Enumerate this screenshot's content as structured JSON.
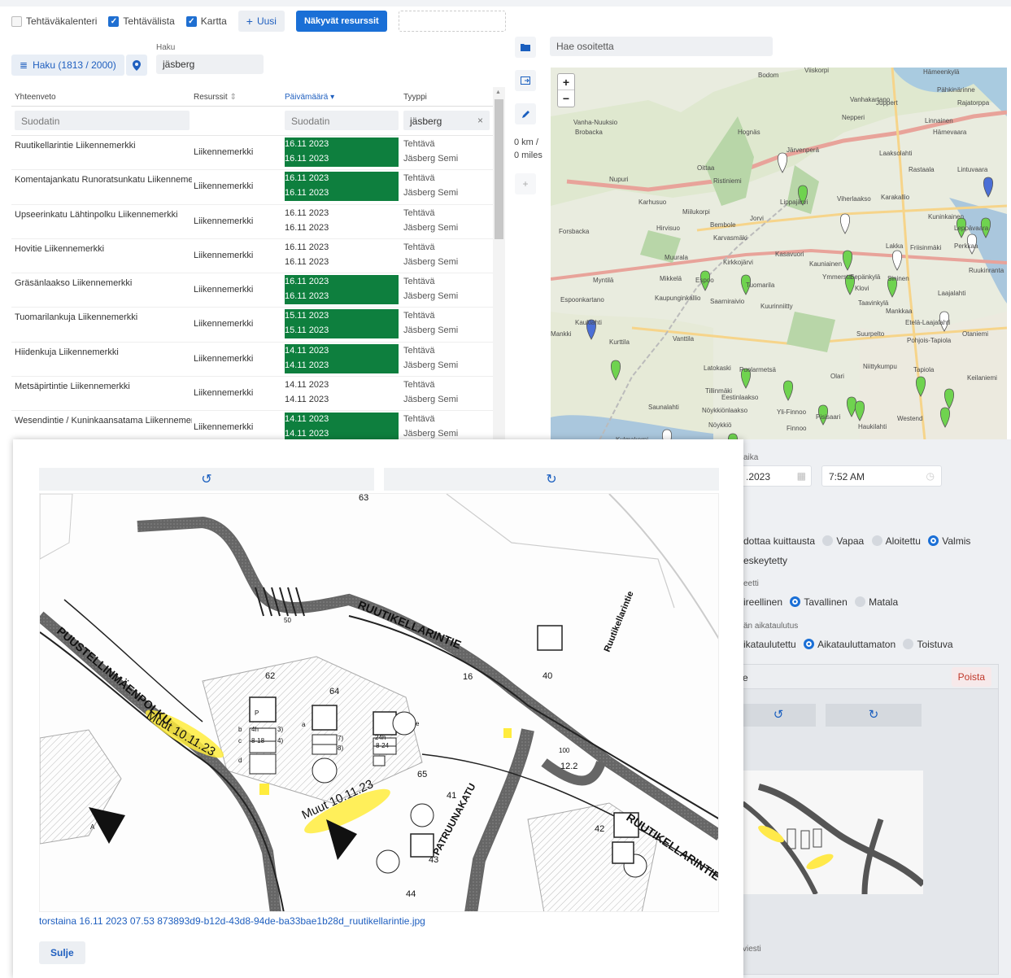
{
  "toolbar": {
    "calendar_label": "Tehtäväkalenteri",
    "list_label": "Tehtävälista",
    "map_label": "Kartta",
    "new_label": "Uusi",
    "resources_label": "Näkyvät resurssit"
  },
  "search": {
    "haku_label": "Haku",
    "button_label": "Haku (1813 / 2000)",
    "value": "jäsberg"
  },
  "table": {
    "headers": {
      "summary": "Yhteenveto",
      "resources": "Resurssit",
      "date": "Päivämäärä",
      "type": "Tyyppi"
    },
    "filter_placeholder": "Suodatin",
    "type_filter": "jäsberg",
    "rows": [
      {
        "summary": "Ruutikellarintie Liikennemerkki",
        "resource": "Liikennemerkki",
        "date1": "16.11 2023",
        "date2": "16.11 2023",
        "green": true,
        "type": "Tehtävä",
        "sub": "Jäsberg Semi"
      },
      {
        "summary": "Komentajankatu Runoratsunkatu Liikennemerkki",
        "resource": "Liikennemerkki",
        "date1": "16.11 2023",
        "date2": "16.11 2023",
        "green": true,
        "type": "Tehtävä",
        "sub": "Jäsberg Semi"
      },
      {
        "summary": "Upseerinkatu Lähtinpolku Liikennemerkki",
        "resource": "Liikennemerkki",
        "date1": "16.11 2023",
        "date2": "16.11 2023",
        "green": false,
        "type": "Tehtävä",
        "sub": "Jäsberg Semi"
      },
      {
        "summary": "Hovitie Liikennemerkki",
        "resource": "Liikennemerkki",
        "date1": "16.11 2023",
        "date2": "16.11 2023",
        "green": false,
        "type": "Tehtävä",
        "sub": "Jäsberg Semi"
      },
      {
        "summary": "Gräsänlaakso Liikennemerkki",
        "resource": "Liikennemerkki",
        "date1": "16.11 2023",
        "date2": "16.11 2023",
        "green": true,
        "type": "Tehtävä",
        "sub": "Jäsberg Semi"
      },
      {
        "summary": "Tuomarilankuja Liikennemerkki",
        "resource": "Liikennemerkki",
        "date1": "15.11 2023",
        "date2": "15.11 2023",
        "green": true,
        "type": "Tehtävä",
        "sub": "Jäsberg Semi"
      },
      {
        "summary": "Hiidenkuja Liikennemerkki",
        "resource": "Liikennemerkki",
        "date1": "14.11 2023",
        "date2": "14.11 2023",
        "green": true,
        "type": "Tehtävä",
        "sub": "Jäsberg Semi"
      },
      {
        "summary": "Metsäpirtintie Liikennemerkki",
        "resource": "Liikennemerkki",
        "date1": "14.11 2023",
        "date2": "14.11 2023",
        "green": false,
        "type": "Tehtävä",
        "sub": "Jäsberg Semi"
      },
      {
        "summary": "Wesendintie / Kuninkaansatama Liikennemerkki",
        "resource": "Liikennemerkki",
        "date1": "14.11 2023",
        "date2": "14.11 2023",
        "green": true,
        "type": "Tehtävä",
        "sub": "Jäsberg Semi"
      }
    ]
  },
  "map": {
    "address_placeholder": "Hae osoitetta",
    "distance_km": "0 km /",
    "distance_miles": "0 miles",
    "zoom_in": "+",
    "zoom_out": "−",
    "places": [
      "Bodom",
      "Viiskorpi",
      "Hämeenkylä",
      "Pähkinärinne",
      "Vanhakartano",
      "Juppert",
      "Rajatorppa",
      "Vanha-Nuuksio",
      "Brobacka",
      "Nepperi",
      "Linnainen",
      "Hämevaara",
      "Hognäs",
      "Järvenperä",
      "Laaksolahti",
      "Oittaa",
      "Ristiniemi",
      "Rastaala",
      "Lintuvaara",
      "Nupuri",
      "Karhusuo",
      "Miilukorpi",
      "Lippajärvi",
      "Viherlaakso",
      "Karakallio",
      "Kuninkainen",
      "Leppävaara",
      "Forsbacka",
      "Hirvisuo",
      "Bembole",
      "Jorvi",
      "Karvasmäki",
      "Lakka",
      "Friisinmäki",
      "Perkkaa",
      "Muurala",
      "Kasavuori",
      "Kauniainen",
      "Ymmersta",
      "Sepänkylä",
      "Sininen",
      "Kirkkojärvi",
      "Kuurinniitty",
      "Myntilä",
      "Mikkelä",
      "Espoo",
      "Tuomarila",
      "Klovi",
      "Ruukinranta",
      "Kaupunginkallio",
      "Saarniraivio",
      "Taavinkylä",
      "Mankkaa",
      "Etelä-Laajalahti",
      "Espoonkartano",
      "Kauklahti",
      "Suurpelto",
      "Otaniemi",
      "Mankki",
      "Vanttila",
      "Pohjois-Tapiola",
      "Kurttila",
      "Latokaski",
      "Puolarmetsä",
      "Olari",
      "Niittykumpu",
      "Tapiola",
      "Keilaniemi",
      "Tillinmäki",
      "Eestinlaakso",
      "Saunalahti",
      "Nöykkiönlaakso",
      "Yli-Finnoo",
      "Pisisaari",
      "Haukilahti",
      "Westend",
      "Nöykkiö",
      "Finnoo",
      "Laajalahti",
      "Kulmakorpi"
    ]
  },
  "modal": {
    "rotate_left": "↺",
    "rotate_right": "↻",
    "plan_labels": {
      "street1": "RUUTIKELLARINTIE",
      "street2": "RUUTIKELLARINTIE",
      "street3": "PUUSTELLINMÄENPOLKU",
      "street4": "PATRUUNAKATU",
      "street5": "Ruutikellarintie",
      "note1": "Muut 10.11.23",
      "note2": "Muut 10.11.23",
      "nums": [
        "63",
        "62",
        "64",
        "40",
        "65",
        "41",
        "42",
        "43",
        "44",
        "16",
        "12.2",
        "50",
        "100",
        "24h",
        "8-24",
        "4h",
        "8-18",
        "3)",
        "4)",
        "7)",
        "8)",
        "a",
        "b",
        "c",
        "d",
        "e",
        "A",
        "P"
      ]
    },
    "file_link": "torstaina 16.11 2023 07.53 873893d9-b12d-43d8-94de-ba33bae1b28d_ruutikellarintie.jpg",
    "close_label": "Sulje"
  },
  "right_panel": {
    "time_label": "aika",
    "date_value": ".2023",
    "time_value": "7:52 AM",
    "status_line1_prefix": "dottaa kuittausta",
    "status_options": [
      "Vapaa",
      "Aloitettu",
      "Valmis"
    ],
    "status_line2": "eskeytetty",
    "priority_label": "eetti",
    "priority_prefix": "ireellinen",
    "priority_options": [
      "Tavallinen",
      "Matala"
    ],
    "schedule_label": "än aikataulutus",
    "schedule_prefix": "ikataulutettu",
    "schedule_options": [
      "Aikatauluttamaton",
      "Toistuva"
    ],
    "attachment_prefix": "e",
    "delete_label": "Poista",
    "rotate_left": "↺",
    "rotate_right": "↻",
    "message_label": "viesti"
  },
  "colors": {
    "accent": "#1a6fd6",
    "green": "#0e7f3e",
    "marker": "#6fd34f"
  }
}
